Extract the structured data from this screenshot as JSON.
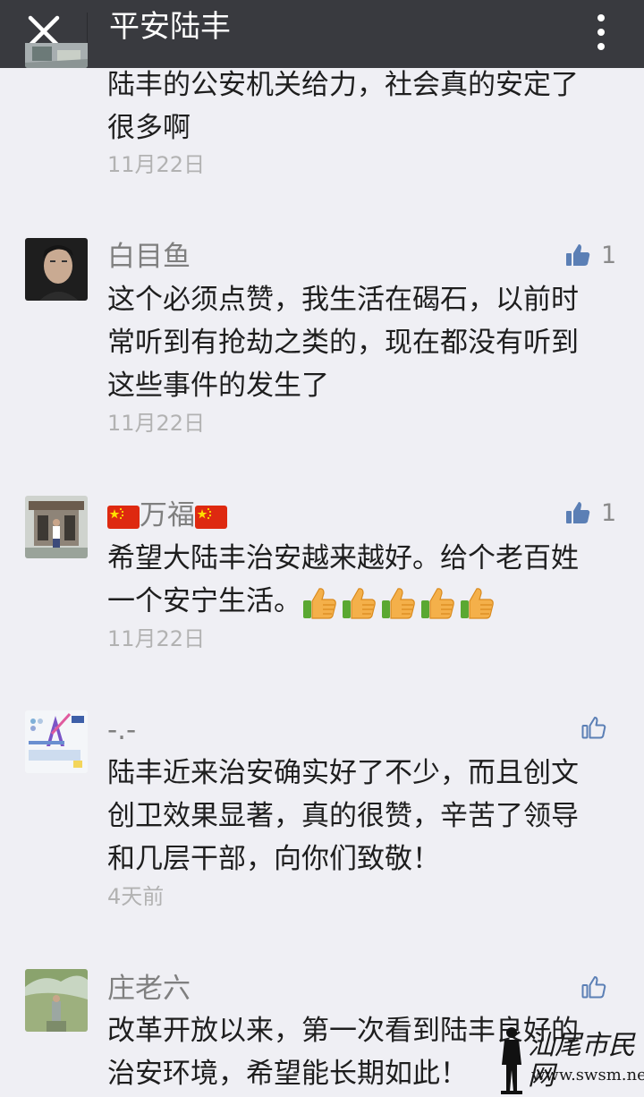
{
  "header": {
    "title": "平安陆丰",
    "close_icon": "close-icon",
    "more_icon": "more-vertical-icon"
  },
  "comments": [
    {
      "username": "",
      "text": "陆丰的公安机关给力，社会真的安定了很多啊",
      "text_lines": [
        "陆丰的公安机关给力，社会真的安定了",
        "很多啊"
      ],
      "date": "11月22日"
    },
    {
      "username": "白目鱼",
      "text_lines": [
        "这个必须点赞，我生活在碣石，以前时",
        "常听到有抢劫之类的，现在都没有听到",
        "这些事件的发生了"
      ],
      "date": "11月22日",
      "likes": "1",
      "liked": true
    },
    {
      "username": "万福",
      "username_decor": "flag-emoji",
      "text_lines": [
        "希望大陆丰治安越来越好。给个老百姓",
        "一个安宁生活。"
      ],
      "emoji": "thumbs-up-emoji",
      "emoji_count": 5,
      "date": "11月22日",
      "likes": "1",
      "liked": true
    },
    {
      "username": "-.-",
      "text_lines": [
        "陆丰近来治安确实好了不少，而且创文",
        "创卫效果显著，真的很赞，辛苦了领导",
        "和几层干部，向你们致敬！"
      ],
      "date": "4天前",
      "liked": false
    },
    {
      "username": "庄老六",
      "text_lines": [
        "改革开放以来，第一次看到陆丰良好的",
        "治安环境，希望能长期如此！"
      ],
      "liked": false
    }
  ],
  "watermark": {
    "text": "汕尾市民网",
    "url": "www.swsm.net"
  },
  "colors": {
    "topbar": "#393a3f",
    "background": "#efeff4",
    "like_active": "#5b7fb5",
    "username": "#7f7f7f",
    "date": "#b2b2b2"
  }
}
